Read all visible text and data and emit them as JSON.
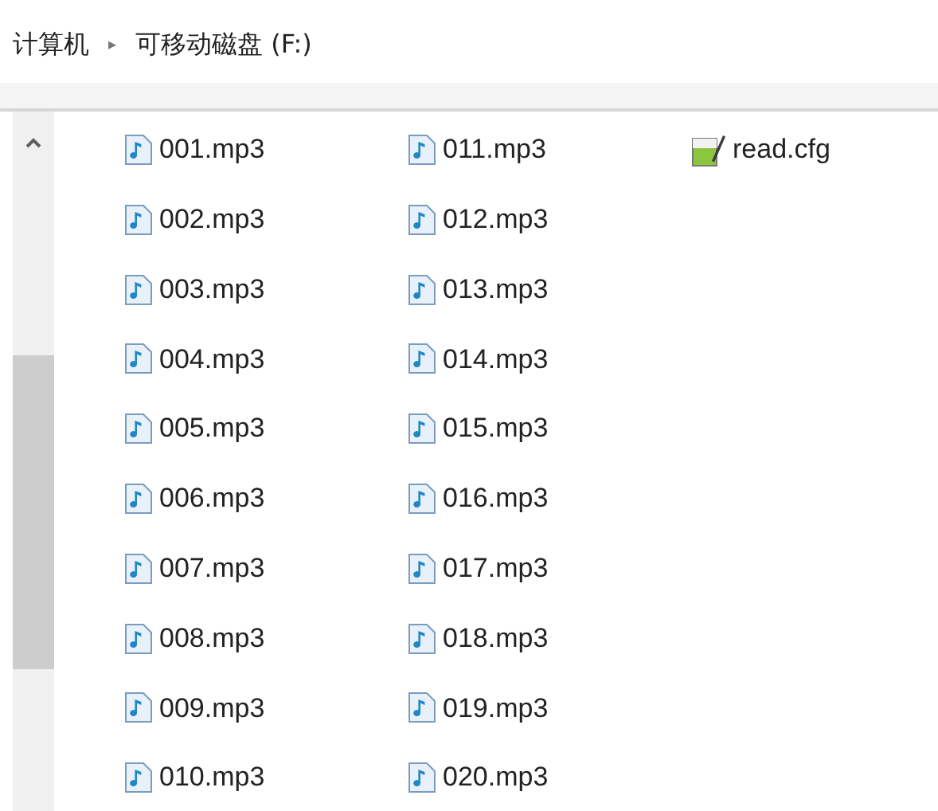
{
  "breadcrumb": {
    "items": [
      "计算机",
      "可移动磁盘 (F:)"
    ],
    "separator": "▸"
  },
  "files": [
    {
      "name": "001.mp3",
      "kind": "audio"
    },
    {
      "name": "002.mp3",
      "kind": "audio"
    },
    {
      "name": "003.mp3",
      "kind": "audio"
    },
    {
      "name": "004.mp3",
      "kind": "audio"
    },
    {
      "name": "005.mp3",
      "kind": "audio"
    },
    {
      "name": "006.mp3",
      "kind": "audio"
    },
    {
      "name": "007.mp3",
      "kind": "audio"
    },
    {
      "name": "008.mp3",
      "kind": "audio"
    },
    {
      "name": "009.mp3",
      "kind": "audio"
    },
    {
      "name": "010.mp3",
      "kind": "audio"
    },
    {
      "name": "011.mp3",
      "kind": "audio"
    },
    {
      "name": "012.mp3",
      "kind": "audio"
    },
    {
      "name": "013.mp3",
      "kind": "audio"
    },
    {
      "name": "014.mp3",
      "kind": "audio"
    },
    {
      "name": "015.mp3",
      "kind": "audio"
    },
    {
      "name": "016.mp3",
      "kind": "audio"
    },
    {
      "name": "017.mp3",
      "kind": "audio"
    },
    {
      "name": "018.mp3",
      "kind": "audio"
    },
    {
      "name": "019.mp3",
      "kind": "audio"
    },
    {
      "name": "020.mp3",
      "kind": "audio"
    },
    {
      "name": "read.cfg",
      "kind": "config"
    }
  ]
}
